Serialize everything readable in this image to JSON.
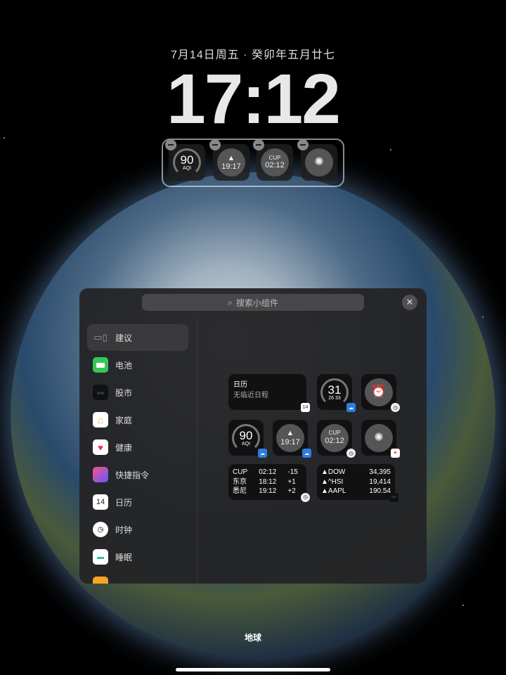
{
  "lock": {
    "date": "7月14日周五 · 癸卯年五月廿七",
    "time": "17:12",
    "widgets": [
      {
        "value": "90",
        "label": "AQI"
      },
      {
        "value": "19:17"
      },
      {
        "label": "CUP",
        "value": "02:12"
      },
      {
        "icon": "fireworks-icon"
      }
    ]
  },
  "gallery": {
    "search_placeholder": "搜索小组件",
    "close": "✕",
    "sidebar": [
      {
        "label": "建议"
      },
      {
        "label": "电池"
      },
      {
        "label": "股市"
      },
      {
        "label": "家庭"
      },
      {
        "label": "健康"
      },
      {
        "label": "快捷指令"
      },
      {
        "label": "日历",
        "icon_text": "14"
      },
      {
        "label": "时钟"
      },
      {
        "label": "睡眠"
      }
    ],
    "calendar": {
      "title": "日历",
      "subtitle": "无临近日程",
      "badge": "14"
    },
    "weather_temp": {
      "value": "31",
      "low": "26",
      "high": "33"
    },
    "aqi": {
      "value": "90",
      "label": "AQI"
    },
    "sunset": "19:17",
    "worldclock": {
      "label": "CUP",
      "value": "02:12"
    },
    "clock_table": [
      [
        "CUP",
        "02:12",
        "-15"
      ],
      [
        "东京",
        "18:12",
        "+1"
      ],
      [
        "悉尼",
        "19:12",
        "+2"
      ]
    ],
    "stocks": [
      [
        "▲DOW",
        "34,395"
      ],
      [
        "▲^HSI",
        "19,414"
      ],
      [
        "▲AAPL",
        "190.54"
      ]
    ]
  },
  "wallpaper_label": "地球",
  "colors": {
    "accent_green": "#34c759"
  }
}
